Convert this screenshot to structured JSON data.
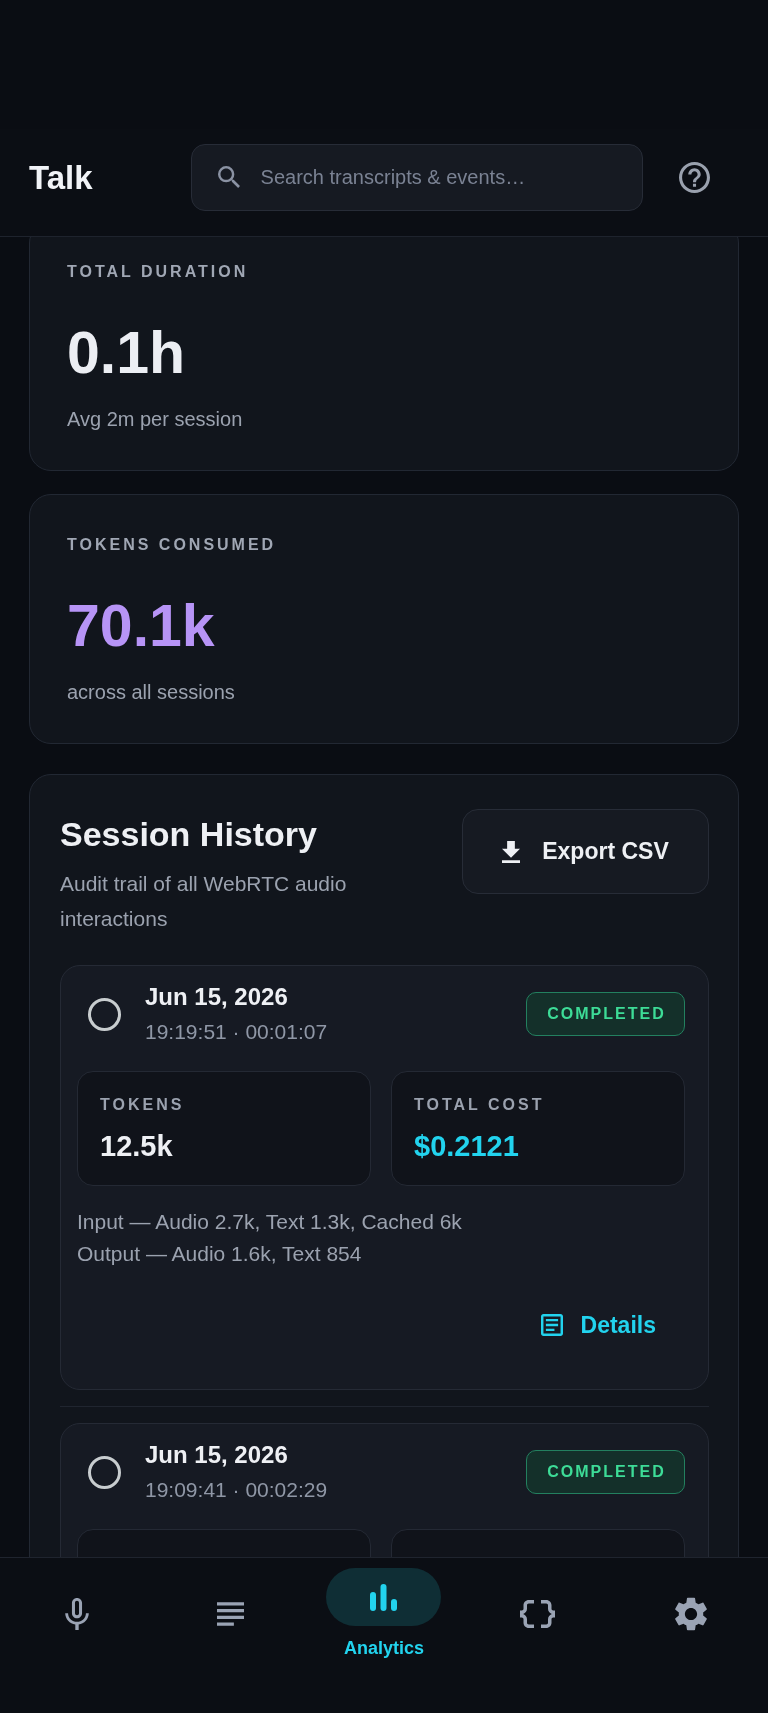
{
  "header": {
    "title": "Talk",
    "search": {
      "placeholder": "Search transcripts & events…"
    }
  },
  "summary_cards": [
    {
      "label": "TOTAL DURATION",
      "value": "0.1h",
      "caption": "Avg 2m per session",
      "color": "#eceef3"
    },
    {
      "label": "TOKENS CONSUMED",
      "value": "70.1k",
      "caption": "across all sessions",
      "color": "#b794f6"
    }
  ],
  "session_history": {
    "title": "Session History",
    "subtitle": "Audit trail of all WebRTC audio interactions",
    "export_button": "Export CSV",
    "sessions": [
      {
        "date": "Jun 15, 2026",
        "time": "19:19:51 · 00:01:07",
        "status": "COMPLETED",
        "selected": false,
        "stats": [
          {
            "label": "TOKENS",
            "value": "12.5k",
            "kind": "count"
          },
          {
            "label": "TOTAL COST",
            "value": "$0.2121",
            "kind": "cost"
          }
        ],
        "breakdown": [
          "Input — Audio 2.7k, Text 1.3k, Cached 6k",
          "Output — Audio 1.6k, Text 854"
        ],
        "details_button": "Details"
      },
      {
        "date": "Jun 15, 2026",
        "time": "19:09:41 · 00:02:29",
        "status": "COMPLETED",
        "selected": false
      }
    ]
  },
  "bottom_nav": [
    {
      "kind": "microphone",
      "selected": false
    },
    {
      "kind": "lines",
      "selected": false
    },
    {
      "kind": "chart",
      "label": "Analytics",
      "selected": true
    },
    {
      "kind": "braces",
      "selected": false
    },
    {
      "kind": "gear",
      "selected": false
    }
  ]
}
